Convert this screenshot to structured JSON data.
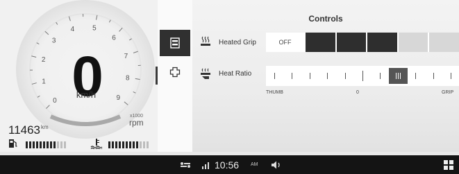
{
  "dash": {
    "speed": "0",
    "speed_unit": "km/h",
    "tach_multiplier": "x1000",
    "tach_unit": "rpm",
    "tach_numbers": [
      "0",
      "1",
      "2",
      "3",
      "4",
      "5",
      "6",
      "7",
      "8",
      "9"
    ],
    "odometer": "11463",
    "odometer_unit": "km",
    "fuel_level": 0.75,
    "coolant_level": 0.75
  },
  "nav": {
    "items": [
      {
        "icon": "card-settings-icon",
        "active": true
      },
      {
        "icon": "puzzle-icon",
        "active": false
      }
    ]
  },
  "controls": {
    "title": "Controls",
    "heated_grip": {
      "label": "Heated Grip",
      "off_label": "OFF",
      "level": 3,
      "levels_total": 5
    },
    "heat_ratio": {
      "label": "Heat Ratio",
      "left_label": "THUMB",
      "center_label": "0",
      "right_label": "GRIP",
      "position": 2,
      "min": -5,
      "max": 5,
      "knob_label": "III"
    }
  },
  "status": {
    "time": "10:56",
    "ampm": "AM"
  },
  "colors": {
    "active": "#2e2e2e",
    "inactive": "#d7d7d7",
    "bar": "#141414"
  }
}
